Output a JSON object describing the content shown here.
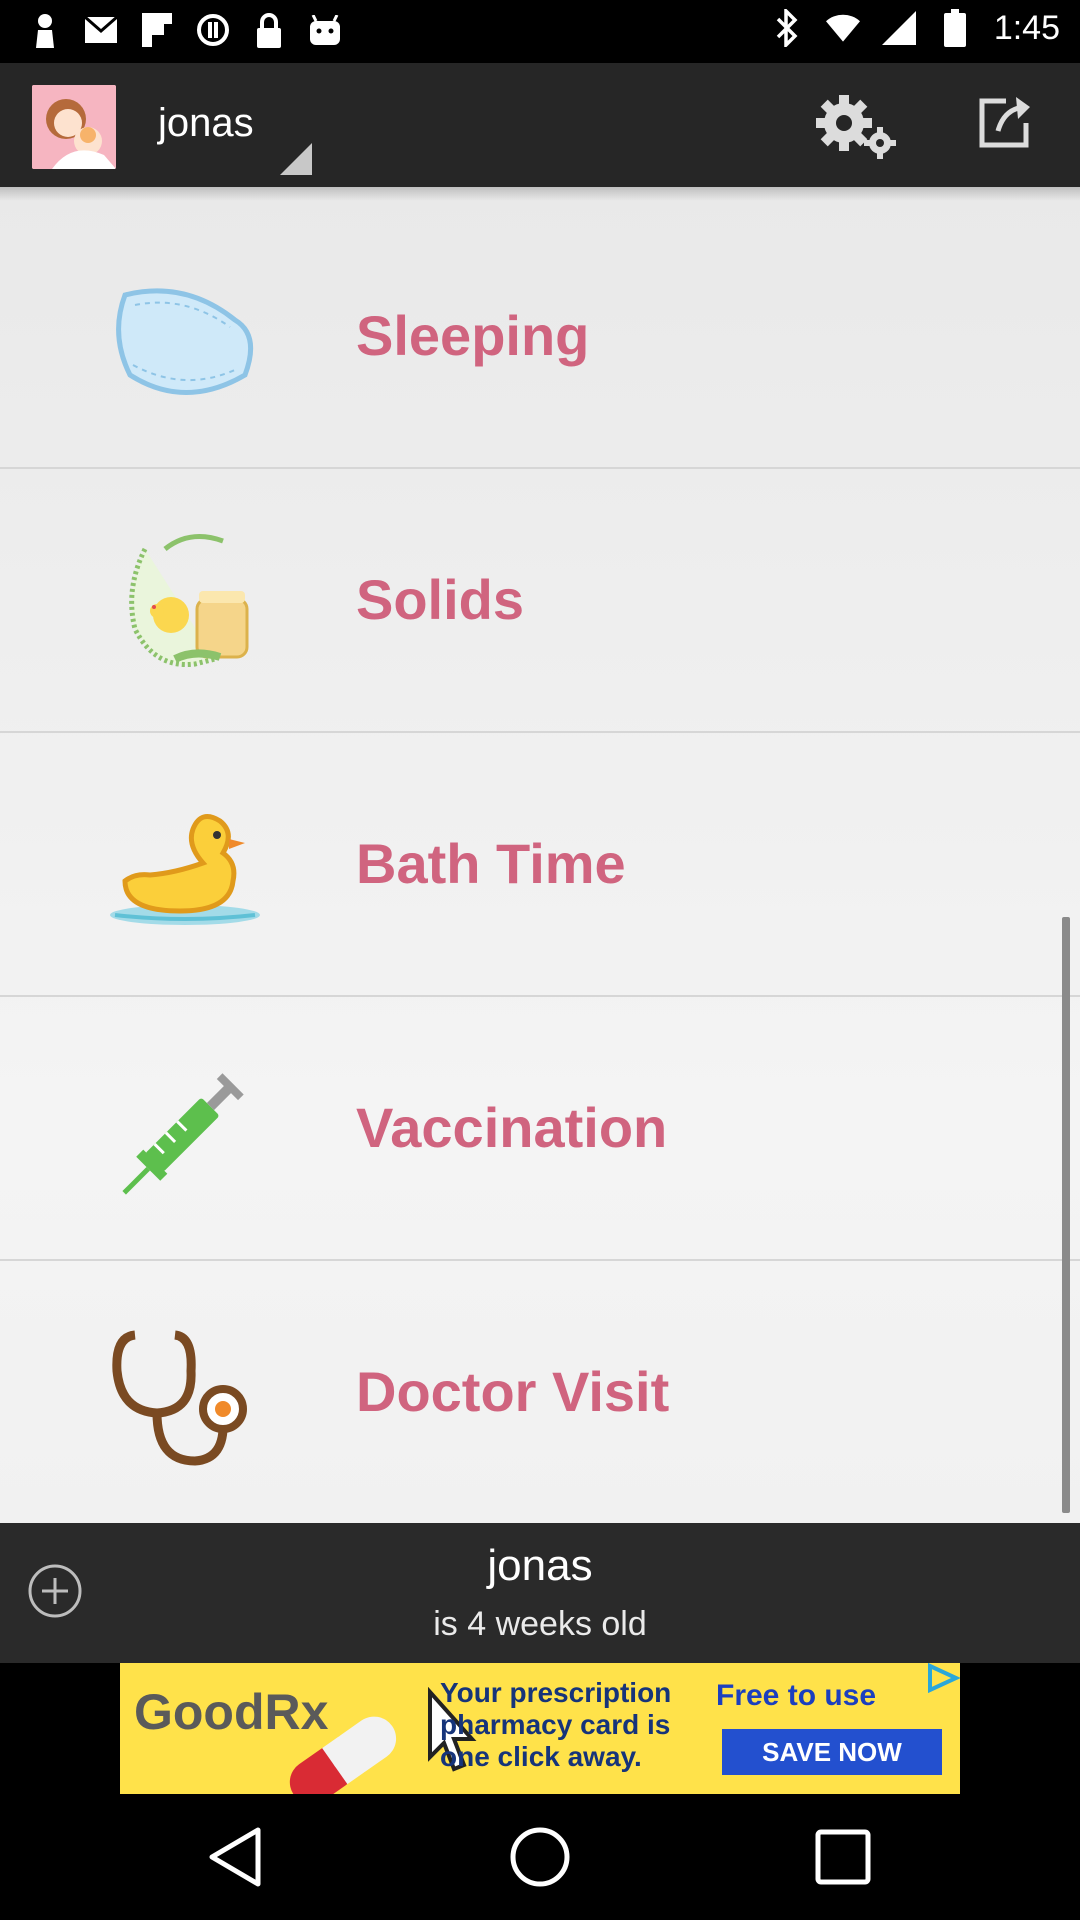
{
  "status_bar": {
    "time": "1:45",
    "left_icons": [
      "person-icon",
      "mail-icon",
      "flipboard-icon",
      "circle-icon",
      "lock-icon",
      "android-icon"
    ],
    "right_icons": [
      "bluetooth-icon",
      "wifi-icon",
      "signal-icon",
      "battery-icon"
    ]
  },
  "app_bar": {
    "account_name": "jonas",
    "icons": [
      "settings-icon",
      "share-icon"
    ]
  },
  "menu": {
    "items": [
      {
        "label": "Sleeping",
        "icon": "pillow-icon"
      },
      {
        "label": "Solids",
        "icon": "bib-icon"
      },
      {
        "label": "Bath Time",
        "icon": "duck-icon"
      },
      {
        "label": "Vaccination",
        "icon": "syringe-icon"
      },
      {
        "label": "Doctor Visit",
        "icon": "stethoscope-icon"
      }
    ]
  },
  "footer": {
    "name": "jonas",
    "age_text": "is 4 weeks old",
    "icon": "add-icon"
  },
  "ad": {
    "brand": "GoodRx",
    "copy": "Your prescription pharmacy card is one click away.",
    "tagline": "Free to use",
    "cta": "SAVE NOW"
  },
  "nav_bar": {
    "icons": [
      "back-icon",
      "home-icon",
      "recents-icon"
    ]
  },
  "colors": {
    "label": "#d0647f",
    "app_bar": "#262626",
    "footer": "#2a2a2a",
    "ad_background": "#ffe24a"
  }
}
